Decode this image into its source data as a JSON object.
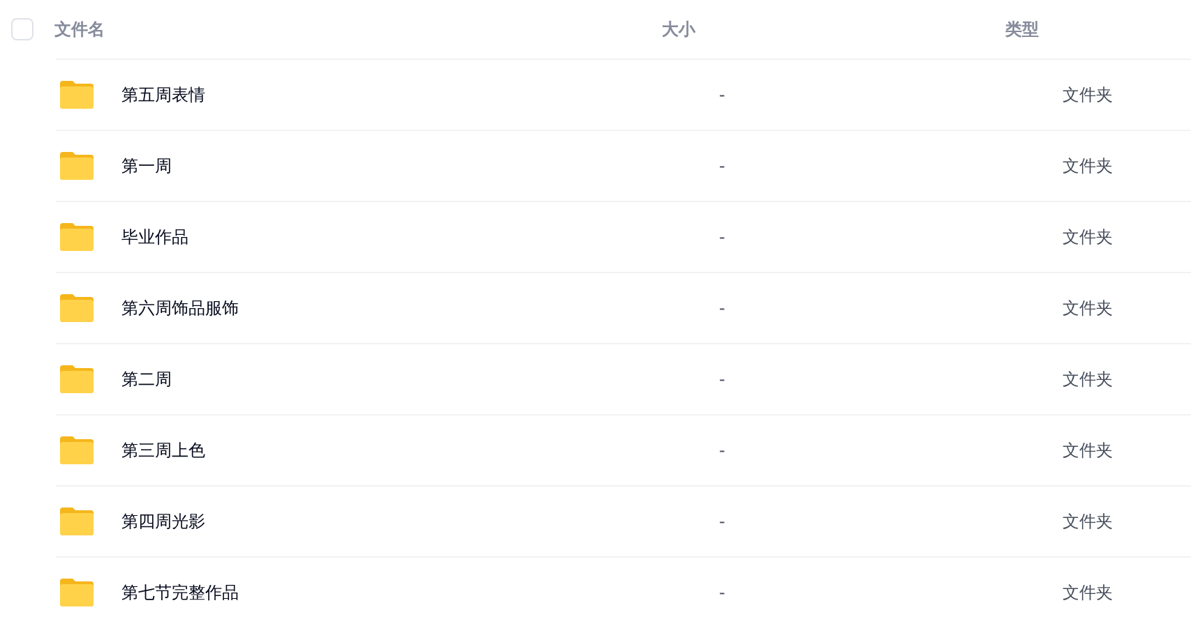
{
  "header": {
    "checked": false,
    "columns": [
      "文件名",
      "大小",
      "类型"
    ]
  },
  "rows": [
    {
      "name": "第五周表情",
      "size": "-",
      "type": "文件夹"
    },
    {
      "name": "第一周",
      "size": "-",
      "type": "文件夹"
    },
    {
      "name": "毕业作品",
      "size": "-",
      "type": "文件夹"
    },
    {
      "name": "第六周饰品服饰",
      "size": "-",
      "type": "文件夹"
    },
    {
      "name": "第二周",
      "size": "-",
      "type": "文件夹"
    },
    {
      "name": "第三周上色",
      "size": "-",
      "type": "文件夹"
    },
    {
      "name": "第四周光影",
      "size": "-",
      "type": "文件夹"
    },
    {
      "name": "第七节完整作品",
      "size": "-",
      "type": "文件夹"
    }
  ]
}
